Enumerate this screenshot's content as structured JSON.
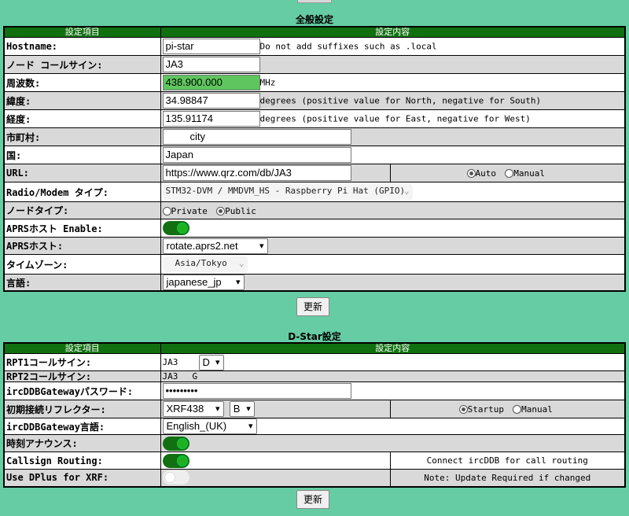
{
  "general": {
    "title": "全般設定",
    "header_item": "設定項目",
    "header_value": "設定内容",
    "hostname_label": "Hostname:",
    "hostname_value": "pi-star",
    "hostname_note": "Do not add suffixes such as .local",
    "callsign_label": "ノード コールサイン:",
    "callsign_value": "JA3",
    "freq_label": "周波数:",
    "freq_value": "438.900.000",
    "freq_unit": "MHz",
    "lat_label": "緯度:",
    "lat_value": "34.98847",
    "lat_note": "degrees (positive value for North, negative for South)",
    "lon_label": "経度:",
    "lon_value": "135.91174",
    "lon_note": "degrees (positive value for East, negative for West)",
    "town_label": "市町村:",
    "town_value": "city",
    "country_label": "国:",
    "country_value": "Japan",
    "url_label": "URL:",
    "url_value": "https://www.qrz.com/db/JA3",
    "url_auto": "Auto",
    "url_manual": "Manual",
    "modem_label": "Radio/Modem タイプ:",
    "modem_value": "STM32-DVM / MMDVM_HS - Raspberry Pi Hat (GPIO)",
    "nodetype_label": "ノードタイプ:",
    "nodetype_private": "Private",
    "nodetype_public": "Public",
    "aprs_enable_label": "APRSホスト Enable:",
    "aprs_host_label": "APRSホスト:",
    "aprs_host_value": "rotate.aprs2.net",
    "tz_label": "タイムゾーン:",
    "tz_value": "Asia/Tokyo",
    "lang_label": "言語:",
    "lang_value": "japanese_jp",
    "apply_label": "更新"
  },
  "dstar": {
    "title": "D-Star設定",
    "header_item": "設定項目",
    "header_value": "設定内容",
    "rpt1_label": "RPT1コールサイン:",
    "rpt1_call": "JA3",
    "rpt1_module": "D",
    "rpt2_label": "RPT2コールサイン:",
    "rpt2_call": "JA3",
    "rpt2_module": "G",
    "pass_label": "ircDDBGatewayパスワード:",
    "pass_value": "•••••••••",
    "reflector_label": "初期接続リフレクター:",
    "reflector_value": "XRF438",
    "reflector_module": "B",
    "startup_label": "Startup",
    "manual_label": "Manual",
    "irclang_label": "ircDDBGateway言語:",
    "irclang_value": "English_(UK)",
    "time_announce_label": "時刻アナウンス:",
    "callsign_routing_label": "Callsign Routing:",
    "callsign_routing_note": "Connect ircDDB for call routing",
    "dplus_label": "Use DPlus for XRF:",
    "dplus_note": "Note: Update Required if changed",
    "apply_label": "更新"
  }
}
